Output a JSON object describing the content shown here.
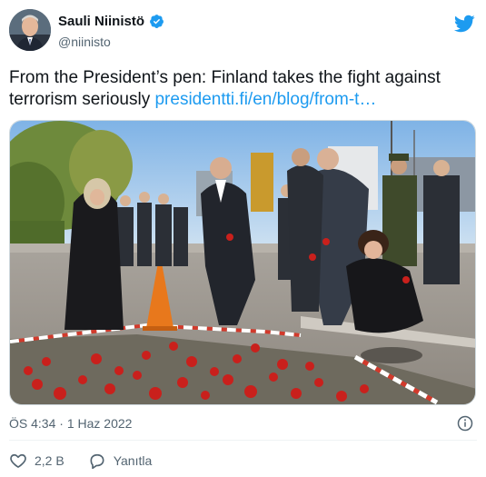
{
  "author": {
    "display_name": "Sauli Niinistö",
    "handle": "@niinisto",
    "verified": true
  },
  "tweet": {
    "text": "From the President’s pen: Finland takes the fight against terrorism seriously ",
    "link_text": "presidentti.fi/en/blog/from-t…"
  },
  "meta": {
    "time": "ÖS 4:34",
    "separator": " · ",
    "date": "1 Haz 2022"
  },
  "actions": {
    "like_count": "2,2 B",
    "reply_label": "Yanıtla"
  },
  "icons": {
    "brand": "twitter-bird-icon",
    "verified": "verified-badge-icon",
    "info": "info-icon",
    "like": "heart-icon",
    "reply": "reply-bubble-icon"
  },
  "colors": {
    "accent": "#1d9bf0",
    "text": "#0f1419",
    "muted": "#536471"
  }
}
